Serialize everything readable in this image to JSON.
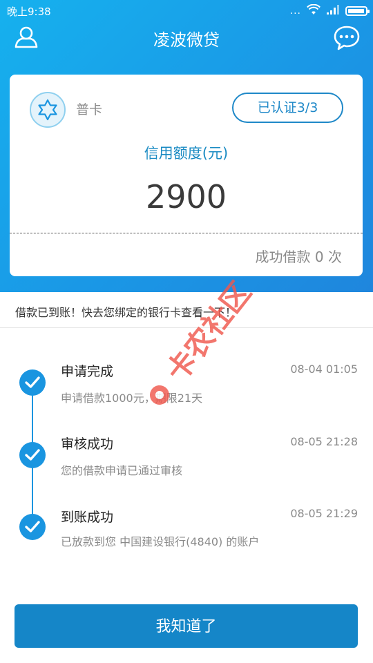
{
  "status_bar": {
    "time": "晚上9:38",
    "dots": "...",
    "battery_level": 0.95
  },
  "header": {
    "title": "凌波微贷",
    "left_icon": "user-icon",
    "right_icon": "chat-bubble-icon"
  },
  "card": {
    "level": "普卡",
    "verify_label": "已认证3/3",
    "credit_label": "信用额度(元)",
    "credit_value": "2900",
    "borrow_count_text": "成功借款 0 次"
  },
  "notice": {
    "text": "借款已到账！快去您绑定的银行卡查看一下！"
  },
  "timeline": [
    {
      "title": "申请完成",
      "time": "08-04 01:05",
      "desc": "申请借款1000元，期限21天"
    },
    {
      "title": "审核成功",
      "time": "08-05 21:28",
      "desc": "您的借款申请已通过审核"
    },
    {
      "title": "到账成功",
      "time": "08-05 21:29",
      "desc": "已放款到您 中国建设银行(4840) 的账户"
    }
  ],
  "button": {
    "ok_label": "我知道了"
  },
  "watermark": {
    "text": "卡农社区"
  },
  "colors": {
    "primary": "#1a95e0",
    "button": "#1586c8",
    "watermark": "#f0584e"
  }
}
